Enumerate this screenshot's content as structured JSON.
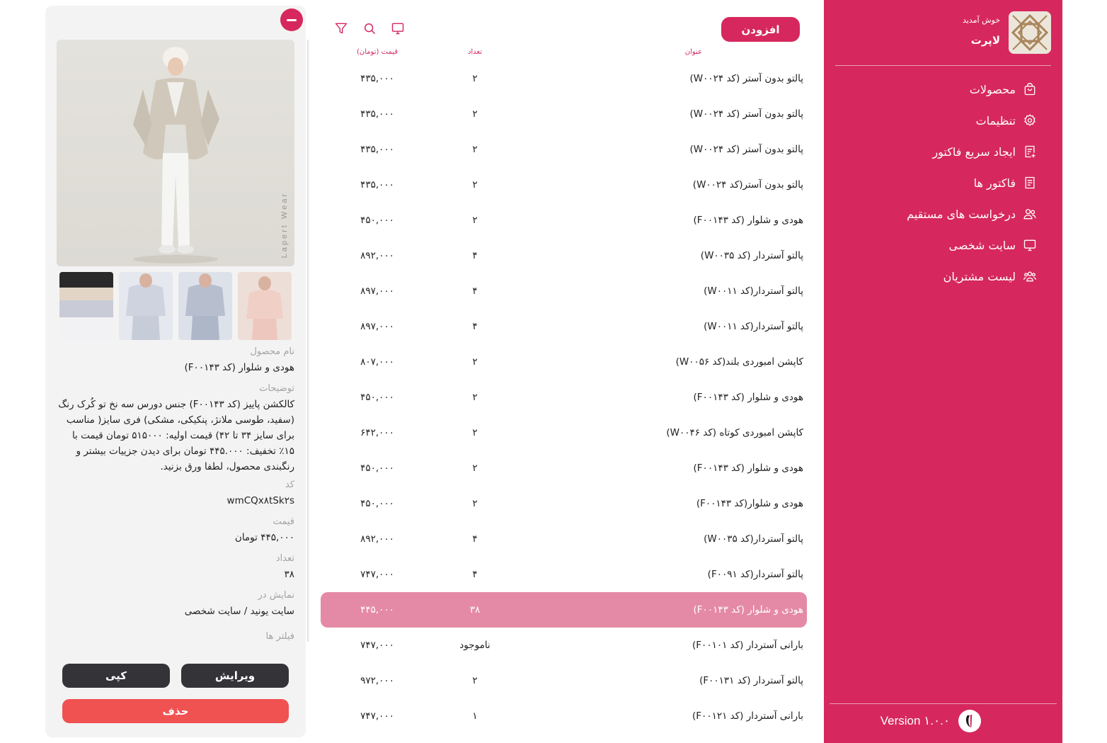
{
  "brand": {
    "welcome": "خوش آمدید",
    "name": "لاپرت"
  },
  "nav": [
    {
      "label": "محصولات",
      "icon": "bag-icon"
    },
    {
      "label": "تنظیمات",
      "icon": "gear-icon"
    },
    {
      "label": "ایجاد سریع فاکتور",
      "icon": "invoice-add-icon"
    },
    {
      "label": "فاکتور ها",
      "icon": "invoice-icon"
    },
    {
      "label": "درخواست های مستقیم",
      "icon": "users-icon"
    },
    {
      "label": "سایت شخصی",
      "icon": "monitor-icon"
    },
    {
      "label": "لیست مشتریان",
      "icon": "customers-icon"
    }
  ],
  "footer": {
    "version": "Version ۱.۰.۰"
  },
  "toolbar": {
    "add_label": "افزودن",
    "icons": [
      "monitor-icon",
      "search-icon",
      "filter-icon"
    ]
  },
  "table": {
    "headers": {
      "title": "عنوان",
      "qty": "تعداد",
      "price": "قیمت (تومان)"
    },
    "rows": [
      {
        "title": "پالتو بدون آستر (کد W۰۰۲۴)",
        "qty": "۲",
        "price": "۴۳۵,۰۰۰"
      },
      {
        "title": "پالتو بدون آستر (کد W۰۰۲۴)",
        "qty": "۲",
        "price": "۴۳۵,۰۰۰"
      },
      {
        "title": "پالتو بدون آستر (کد W۰۰۲۴)",
        "qty": "۲",
        "price": "۴۳۵,۰۰۰"
      },
      {
        "title": "پالتو بدون آستر(کد W۰۰۲۴)",
        "qty": "۲",
        "price": "۴۳۵,۰۰۰"
      },
      {
        "title": "هودی و شلوار (کد F۰۰۱۴۳)",
        "qty": "۲",
        "price": "۴۵۰,۰۰۰"
      },
      {
        "title": "پالتو آستردار (کد W۰۰۳۵)",
        "qty": "۴",
        "price": "۸۹۲,۰۰۰"
      },
      {
        "title": "پالتو آستردار(کد W۰۰۱۱)",
        "qty": "۴",
        "price": "۸۹۷,۰۰۰"
      },
      {
        "title": "پالتو آستردار(کد W۰۰۱۱)",
        "qty": "۴",
        "price": "۸۹۷,۰۰۰"
      },
      {
        "title": "کاپشن امبوردی بلند(کد W۰۰۵۶)",
        "qty": "۲",
        "price": "۸۰۷,۰۰۰"
      },
      {
        "title": "هودی و شلوار (کد F۰۰۱۴۳)",
        "qty": "۲",
        "price": "۴۵۰,۰۰۰"
      },
      {
        "title": "کاپشن امبوردی کوتاه (کد W۰۰۴۶)",
        "qty": "۲",
        "price": "۶۴۲,۰۰۰"
      },
      {
        "title": "هودی و شلوار (کد F۰۰۱۴۳)",
        "qty": "۲",
        "price": "۴۵۰,۰۰۰"
      },
      {
        "title": "هودی و شلوار(کد F۰۰۱۴۳)",
        "qty": "۲",
        "price": "۴۵۰,۰۰۰"
      },
      {
        "title": "پالتو آستردار(کد W۰۰۳۵)",
        "qty": "۴",
        "price": "۸۹۲,۰۰۰"
      },
      {
        "title": "پالتو آستردار(کد F۰۰۹۱)",
        "qty": "۴",
        "price": "۷۴۷,۰۰۰"
      },
      {
        "title": "هودی و شلوار (کد F۰۰۱۴۳)",
        "qty": "۳۸",
        "price": "۴۴۵,۰۰۰",
        "selected": true
      },
      {
        "title": "بارانی آستردار (کد F۰۰۱۰۱)",
        "qty": "ناموجود",
        "price": "۷۴۷,۰۰۰"
      },
      {
        "title": "پالتو آستردار (کد F۰۰۱۳۱)",
        "qty": "۲",
        "price": "۹۷۲,۰۰۰"
      },
      {
        "title": "بارانی آستردار (کد F۰۰۱۲۱)",
        "qty": "۱",
        "price": "۷۴۷,۰۰۰"
      }
    ]
  },
  "detail": {
    "image_watermark": "Lapert Wear",
    "labels": {
      "name": "نام محصول",
      "description": "توضیحات",
      "code": "کد",
      "price": "قیمت",
      "quantity": "تعداد",
      "display_in": "نمایش در",
      "filters": "فیلتر ها"
    },
    "values": {
      "name": "هودی و شلوار (کد F۰۰۱۴۳)",
      "description": "کالکشن پاییز (کد F۰۰۱۴۳) جنس دورس سه نخ تو کُرک رنگ (سفید، طوسی ملانژ، پنکیکی، مشکی) فری سایز( مناسب برای سایز ۳۴ تا ۴۲) قیمت اولیه: ۵۱۵۰۰۰ تومان قیمت با ۱۵٪ تخفیف: ۴۴۵.۰۰۰ تومان برای دیدن جزییات بیشتر و رنگبندی محصول، لطفا ورق بزنید.",
      "code": "wmCQx۸tSk۲s",
      "price": "۴۴۵,۰۰۰ تومان",
      "quantity": "۳۸",
      "display_in": "سایت یونید / سایت شخصی"
    },
    "buttons": {
      "edit": "ویرایش",
      "copy": "کپی",
      "delete": "حذف"
    }
  },
  "colors": {
    "brand": "#d6285e",
    "selected_row": "#e58aa6",
    "delete": "#f05252",
    "dark_button": "#333338"
  }
}
